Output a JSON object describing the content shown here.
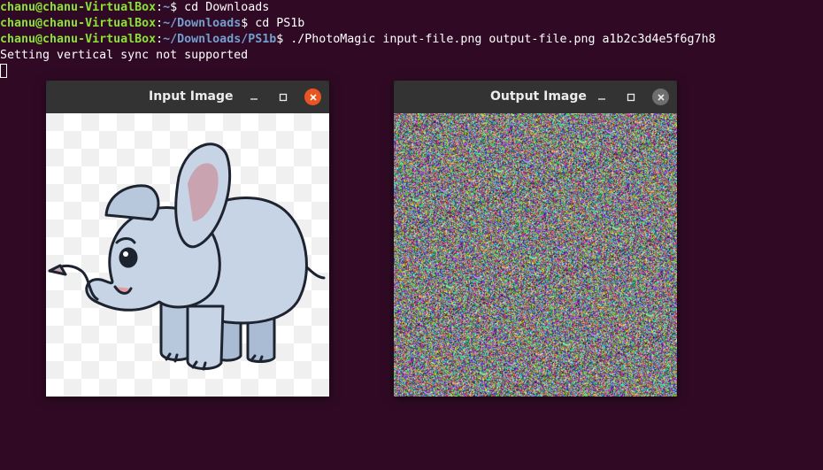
{
  "terminal": {
    "lines": [
      {
        "user": "chanu@chanu-VirtualBox",
        "sep": ":",
        "path": "~",
        "prompt": "$ ",
        "command": "cd Downloads"
      },
      {
        "user": "chanu@chanu-VirtualBox",
        "sep": ":",
        "path": "~/Downloads",
        "prompt": "$ ",
        "command": "cd PS1b"
      },
      {
        "user": "chanu@chanu-VirtualBox",
        "sep": ":",
        "path": "~/Downloads/PS1b",
        "prompt": "$ ",
        "command": "./PhotoMagic input-file.png output-file.png a1b2c3d4e5f6g7h8"
      }
    ],
    "output": "Setting vertical sync not supported"
  },
  "windows": {
    "input": {
      "title": "Input Image"
    },
    "output": {
      "title": "Output Image"
    }
  },
  "colors": {
    "background": "#300a24",
    "user": "#8ae234",
    "path": "#729fcf",
    "close_active": "#e95420"
  }
}
